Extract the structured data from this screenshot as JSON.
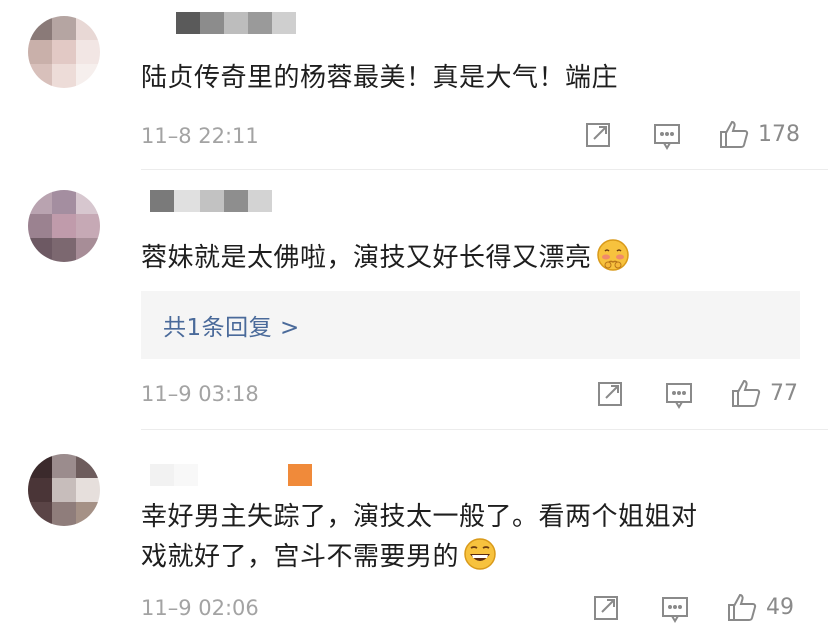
{
  "comments": [
    {
      "text": "陆贞传奇里的杨蓉最美！真是大气！端庄",
      "time": "11–8 22:11",
      "likes": "178",
      "emoji": null
    },
    {
      "text": "蓉妹就是太佛啦，演技又好长得又漂亮",
      "time": "11–9 03:18",
      "likes": "77",
      "emoji": "blushing-face-emoji",
      "reply_link": "共1条回复 >"
    },
    {
      "text_line1": "幸好男主失踪了，演技太一般了。看两个姐姐对",
      "text_line2": "戏就好了，宫斗不需要男的",
      "time": "11–9 02:06",
      "likes": "49",
      "emoji": "grinning-face-emoji"
    }
  ],
  "icons": {
    "share": "share-icon",
    "comment": "comment-icon",
    "like": "thumbs-up-icon"
  },
  "colors": {
    "link": "#4a6a9a",
    "meta": "#a3a3a3",
    "icon": "#8a8a8a"
  }
}
